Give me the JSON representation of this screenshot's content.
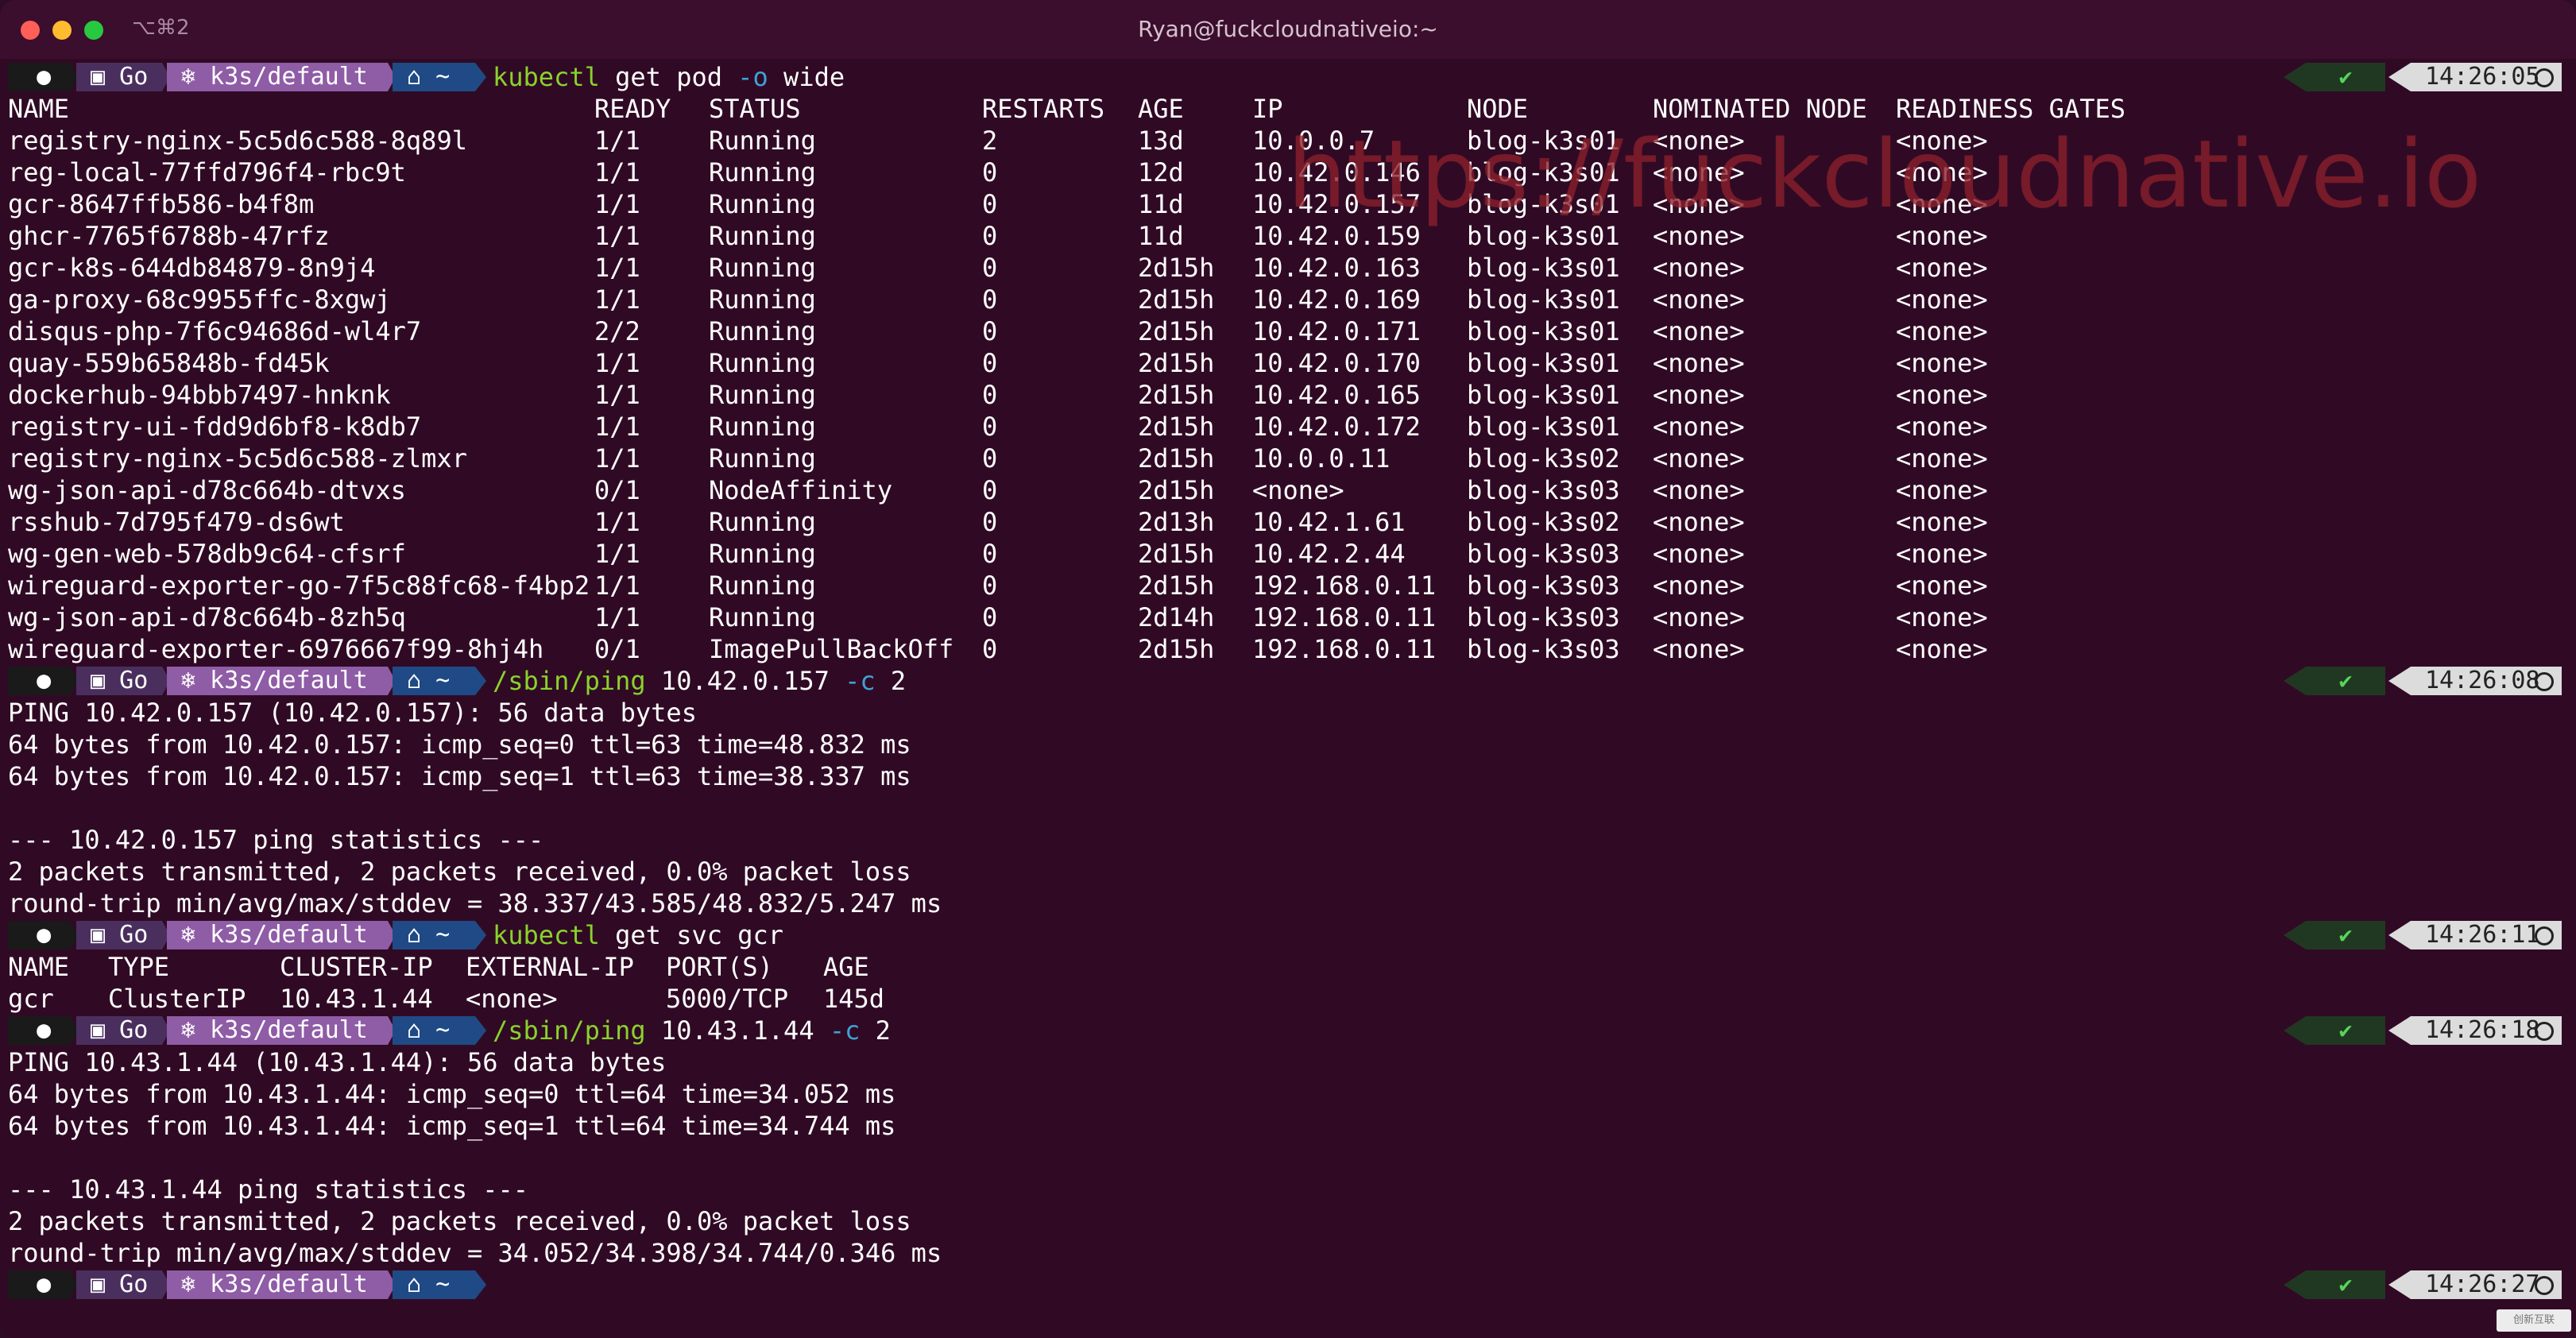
{
  "window": {
    "shortcut": "⌥⌘2",
    "title": "Ryan@fuckcloudnativeio:~",
    "colors": {
      "close": "#ff5f57",
      "minimize": "#febc2e",
      "zoom": "#28c840"
    }
  },
  "prompt": {
    "apple": "",
    "go": "Go",
    "context": "k3s/default",
    "home": "~"
  },
  "blocks": [
    {
      "cmd": {
        "bin": "kubectl",
        "args": [
          " get pod ",
          "-o",
          " wide"
        ]
      },
      "time": "14:26:05",
      "table": {
        "headers": [
          "NAME",
          "READY",
          "STATUS",
          "RESTARTS",
          "AGE",
          "IP",
          "NODE",
          "NOMINATED NODE",
          "READINESS GATES"
        ],
        "rows": [
          [
            "registry-nginx-5c5d6c588-8q89l",
            "1/1",
            "Running",
            "2",
            "13d",
            "10.0.0.7",
            "blog-k3s01",
            "<none>",
            "<none>"
          ],
          [
            "reg-local-77ffd796f4-rbc9t",
            "1/1",
            "Running",
            "0",
            "12d",
            "10.42.0.146",
            "blog-k3s01",
            "<none>",
            "<none>"
          ],
          [
            "gcr-8647ffb586-b4f8m",
            "1/1",
            "Running",
            "0",
            "11d",
            "10.42.0.157",
            "blog-k3s01",
            "<none>",
            "<none>"
          ],
          [
            "ghcr-7765f6788b-47rfz",
            "1/1",
            "Running",
            "0",
            "11d",
            "10.42.0.159",
            "blog-k3s01",
            "<none>",
            "<none>"
          ],
          [
            "gcr-k8s-644db84879-8n9j4",
            "1/1",
            "Running",
            "0",
            "2d15h",
            "10.42.0.163",
            "blog-k3s01",
            "<none>",
            "<none>"
          ],
          [
            "ga-proxy-68c9955ffc-8xgwj",
            "1/1",
            "Running",
            "0",
            "2d15h",
            "10.42.0.169",
            "blog-k3s01",
            "<none>",
            "<none>"
          ],
          [
            "disqus-php-7f6c94686d-wl4r7",
            "2/2",
            "Running",
            "0",
            "2d15h",
            "10.42.0.171",
            "blog-k3s01",
            "<none>",
            "<none>"
          ],
          [
            "quay-559b65848b-fd45k",
            "1/1",
            "Running",
            "0",
            "2d15h",
            "10.42.0.170",
            "blog-k3s01",
            "<none>",
            "<none>"
          ],
          [
            "dockerhub-94bbb7497-hnknk",
            "1/1",
            "Running",
            "0",
            "2d15h",
            "10.42.0.165",
            "blog-k3s01",
            "<none>",
            "<none>"
          ],
          [
            "registry-ui-fdd9d6bf8-k8db7",
            "1/1",
            "Running",
            "0",
            "2d15h",
            "10.42.0.172",
            "blog-k3s01",
            "<none>",
            "<none>"
          ],
          [
            "registry-nginx-5c5d6c588-zlmxr",
            "1/1",
            "Running",
            "0",
            "2d15h",
            "10.0.0.11",
            "blog-k3s02",
            "<none>",
            "<none>"
          ],
          [
            "wg-json-api-d78c664b-dtvxs",
            "0/1",
            "NodeAffinity",
            "0",
            "2d15h",
            "<none>",
            "blog-k3s03",
            "<none>",
            "<none>"
          ],
          [
            "rsshub-7d795f479-ds6wt",
            "1/1",
            "Running",
            "0",
            "2d13h",
            "10.42.1.61",
            "blog-k3s02",
            "<none>",
            "<none>"
          ],
          [
            "wg-gen-web-578db9c64-cfsrf",
            "1/1",
            "Running",
            "0",
            "2d15h",
            "10.42.2.44",
            "blog-k3s03",
            "<none>",
            "<none>"
          ],
          [
            "wireguard-exporter-go-7f5c88fc68-f4bp2",
            "1/1",
            "Running",
            "0",
            "2d15h",
            "192.168.0.11",
            "blog-k3s03",
            "<none>",
            "<none>"
          ],
          [
            "wg-json-api-d78c664b-8zh5q",
            "1/1",
            "Running",
            "0",
            "2d14h",
            "192.168.0.11",
            "blog-k3s03",
            "<none>",
            "<none>"
          ],
          [
            "wireguard-exporter-6976667f99-8hj4h",
            "0/1",
            "ImagePullBackOff",
            "0",
            "2d15h",
            "192.168.0.11",
            "blog-k3s03",
            "<none>",
            "<none>"
          ]
        ]
      }
    },
    {
      "cmd": {
        "bin": "/sbin/ping",
        "args": [
          " 10.42.0.157 ",
          "-c",
          " 2"
        ]
      },
      "time": "14:26:08",
      "output": [
        "PING 10.42.0.157 (10.42.0.157): 56 data bytes",
        "64 bytes from 10.42.0.157: icmp_seq=0 ttl=63 time=48.832 ms",
        "64 bytes from 10.42.0.157: icmp_seq=1 ttl=63 time=38.337 ms",
        "",
        "--- 10.42.0.157 ping statistics ---",
        "2 packets transmitted, 2 packets received, 0.0% packet loss",
        "round-trip min/avg/max/stddev = 38.337/43.585/48.832/5.247 ms"
      ]
    },
    {
      "cmd": {
        "bin": "kubectl",
        "args": [
          " get svc gcr",
          "",
          ""
        ]
      },
      "time": "14:26:11",
      "table": {
        "headers": [
          "NAME",
          "TYPE",
          "CLUSTER-IP",
          "EXTERNAL-IP",
          "PORT(S)",
          "AGE"
        ],
        "rows": [
          [
            "gcr",
            "ClusterIP",
            "10.43.1.44",
            "<none>",
            "5000/TCP",
            "145d"
          ]
        ]
      }
    },
    {
      "cmd": {
        "bin": "/sbin/ping",
        "args": [
          " 10.43.1.44 ",
          "-c",
          " 2"
        ]
      },
      "time": "14:26:18",
      "output": [
        "PING 10.43.1.44 (10.43.1.44): 56 data bytes",
        "64 bytes from 10.43.1.44: icmp_seq=0 ttl=64 time=34.052 ms",
        "64 bytes from 10.43.1.44: icmp_seq=1 ttl=64 time=34.744 ms",
        "",
        "--- 10.43.1.44 ping statistics ---",
        "2 packets transmitted, 2 packets received, 0.0% packet loss",
        "round-trip min/avg/max/stddev = 34.052/34.398/34.744/0.346 ms"
      ]
    }
  ],
  "final_prompt_time": "14:26:27",
  "watermark": "https://fuckcloudnative.io",
  "corner_logo": "创新互联"
}
